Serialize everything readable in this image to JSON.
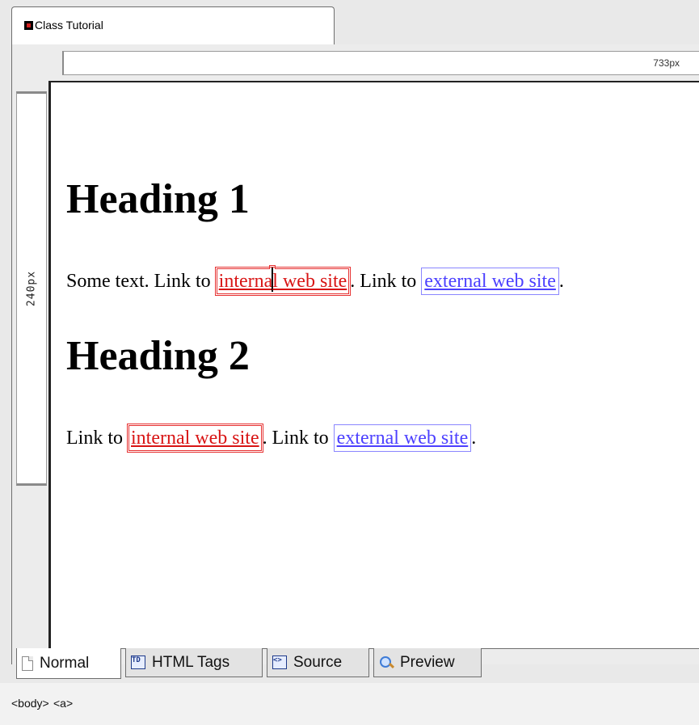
{
  "document_tab": {
    "title": "Class Tutorial"
  },
  "rulers": {
    "horizontal_label": "733px",
    "vertical_label": "240px"
  },
  "content": {
    "heading1": "Heading 1",
    "paragraph1": {
      "text_before": "Some text. Link to",
      "internal_link_a": "interna",
      "internal_link_b": "l web site",
      "text_middle": ". Link to",
      "external_link": "external web site",
      "text_after": "."
    },
    "heading2": "Heading 2",
    "paragraph2": {
      "text_before": "Link to",
      "internal_link": "internal web site",
      "text_middle": ". Link to",
      "external_link": "external web site",
      "text_after": "."
    }
  },
  "view_tabs": [
    {
      "label": "Normal",
      "icon": "page-icon",
      "active": true
    },
    {
      "label": "HTML Tags",
      "icon": "td-icon",
      "icon_text": "TD"
    },
    {
      "label": "Source",
      "icon": "source-icon",
      "icon_text": "<>"
    },
    {
      "label": "Preview",
      "icon": "magnifier-icon"
    }
  ],
  "status_bar": {
    "breadcrumbs": [
      "<body>",
      "<a>"
    ]
  },
  "colors": {
    "internal_link": "#d81414",
    "external_link": "#4c40ff"
  }
}
